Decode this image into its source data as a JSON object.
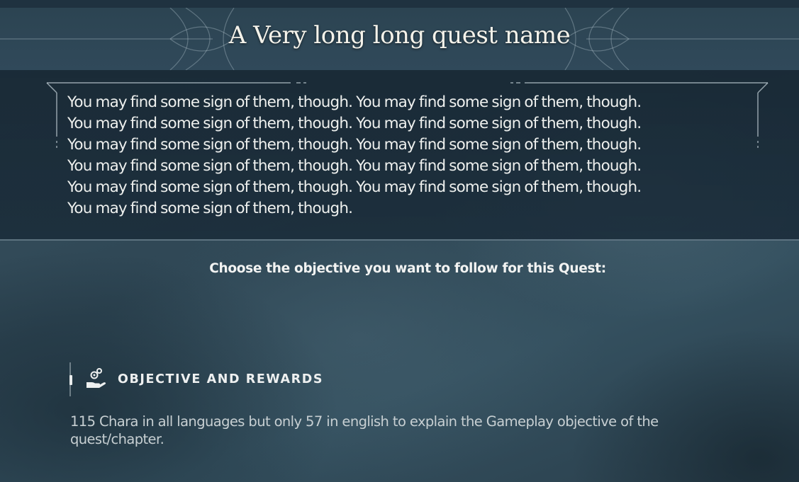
{
  "quest": {
    "title": "A Very long long quest name",
    "description": "You may find some sign of them, though. You may find some sign of them, though.\nYou may find some sign of them, though. You may find some sign of them, though.\nYou may find some sign of them, though. You may find some sign of them, though.\nYou may find some sign of them, though. You may find some sign of them, though.\nYou may find some sign of them, though. You may find some sign of them, though.\nYou may find some sign of them, though."
  },
  "prompt": "Choose the objective you want to follow for this Quest:",
  "objective": {
    "icon": "hand-coins-icon",
    "label": "OBJECTIVE AND REWARDS",
    "description": "115 Chara in all languages but only 57 in english to explain the Gameplay objective of the quest/chapter."
  },
  "colors": {
    "background": "#2f4553",
    "panel": "#1a2c3a",
    "text": "#eef0ee",
    "muted_text": "#c7cfd2"
  }
}
